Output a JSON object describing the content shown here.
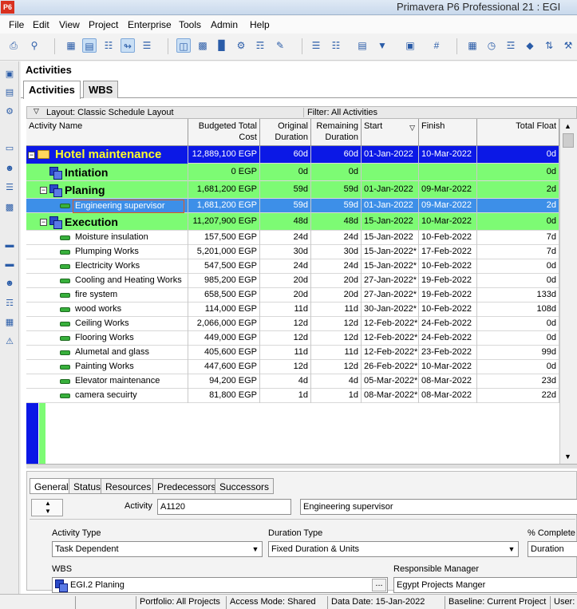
{
  "app": {
    "icon_text": "P6",
    "title": "Primavera P6 Professional 21 : EGI"
  },
  "menu": [
    "File",
    "Edit",
    "View",
    "Project",
    "Enterprise",
    "Tools",
    "Admin",
    "Help"
  ],
  "panel_title": "Activities",
  "top_tabs": [
    "Activities",
    "WBS"
  ],
  "layout_label": "Layout: Classic Schedule Layout",
  "filter_label": "Filter: All Activities",
  "columns": [
    {
      "label": "Activity Name"
    },
    {
      "label": "Budgeted Total Cost"
    },
    {
      "label": "Original Duration"
    },
    {
      "label": "Remaining Duration"
    },
    {
      "label": "Start"
    },
    {
      "label": "Finish"
    },
    {
      "label": "Total Float"
    }
  ],
  "rows": [
    {
      "type": "proj",
      "name": "Hotel maintenance",
      "cost": "12,889,100 EGP",
      "od": "60d",
      "rd": "60d",
      "start": "01-Jan-2022",
      "finish": "10-Mar-2022",
      "tf": "0d"
    },
    {
      "type": "wbs",
      "name": "Intiation",
      "cost": "0 EGP",
      "od": "0d",
      "rd": "0d",
      "start": "",
      "finish": "",
      "tf": "0d"
    },
    {
      "type": "wbs",
      "name": "Planing",
      "cost": "1,681,200 EGP",
      "od": "59d",
      "rd": "59d",
      "start": "01-Jan-2022",
      "finish": "09-Mar-2022",
      "tf": "2d"
    },
    {
      "type": "sel",
      "name": "Engineering supervisor",
      "cost": "1,681,200 EGP",
      "od": "59d",
      "rd": "59d",
      "start": "01-Jan-2022",
      "finish": "09-Mar-2022",
      "tf": "2d"
    },
    {
      "type": "wbs",
      "name": "Execution",
      "cost": "11,207,900 EGP",
      "od": "48d",
      "rd": "48d",
      "start": "15-Jan-2022",
      "finish": "10-Mar-2022",
      "tf": "0d"
    },
    {
      "type": "act",
      "name": "Moisture insulation",
      "cost": "157,500 EGP",
      "od": "24d",
      "rd": "24d",
      "start": "15-Jan-2022",
      "finish": "10-Feb-2022",
      "tf": "7d"
    },
    {
      "type": "act",
      "name": "Plumping Works",
      "cost": "5,201,000 EGP",
      "od": "30d",
      "rd": "30d",
      "start": "15-Jan-2022*",
      "finish": "17-Feb-2022",
      "tf": "7d"
    },
    {
      "type": "act",
      "name": "Electricity Works",
      "cost": "547,500 EGP",
      "od": "24d",
      "rd": "24d",
      "start": "15-Jan-2022*",
      "finish": "10-Feb-2022",
      "tf": "0d"
    },
    {
      "type": "act",
      "name": "Cooling and Heating Works",
      "cost": "985,200 EGP",
      "od": "20d",
      "rd": "20d",
      "start": "27-Jan-2022*",
      "finish": "19-Feb-2022",
      "tf": "0d"
    },
    {
      "type": "act",
      "name": "fire system",
      "cost": "658,500 EGP",
      "od": "20d",
      "rd": "20d",
      "start": "27-Jan-2022*",
      "finish": "19-Feb-2022",
      "tf": "133d"
    },
    {
      "type": "act",
      "name": "wood works",
      "cost": "114,000 EGP",
      "od": "11d",
      "rd": "11d",
      "start": "30-Jan-2022*",
      "finish": "10-Feb-2022",
      "tf": "108d"
    },
    {
      "type": "act",
      "name": "Ceiling Works",
      "cost": "2,066,000 EGP",
      "od": "12d",
      "rd": "12d",
      "start": "12-Feb-2022*",
      "finish": "24-Feb-2022",
      "tf": "0d"
    },
    {
      "type": "act",
      "name": "Flooring Works",
      "cost": "449,000 EGP",
      "od": "12d",
      "rd": "12d",
      "start": "12-Feb-2022*",
      "finish": "24-Feb-2022",
      "tf": "0d"
    },
    {
      "type": "act",
      "name": "Alumetal and glass",
      "cost": "405,600 EGP",
      "od": "11d",
      "rd": "11d",
      "start": "12-Feb-2022*",
      "finish": "23-Feb-2022",
      "tf": "99d"
    },
    {
      "type": "act",
      "name": "Painting Works",
      "cost": "447,600 EGP",
      "od": "12d",
      "rd": "12d",
      "start": "26-Feb-2022*",
      "finish": "10-Mar-2022",
      "tf": "0d"
    },
    {
      "type": "act",
      "name": "Elevator maintenance",
      "cost": "94,200 EGP",
      "od": "4d",
      "rd": "4d",
      "start": "05-Mar-2022*",
      "finish": "08-Mar-2022",
      "tf": "23d"
    },
    {
      "type": "act",
      "name": "camera secuirty",
      "cost": "81,800 EGP",
      "od": "1d",
      "rd": "1d",
      "start": "08-Mar-2022*",
      "finish": "08-Mar-2022",
      "tf": "22d"
    }
  ],
  "detail_tabs": [
    "General",
    "Status",
    "Resources",
    "Predecessors",
    "Successors"
  ],
  "details": {
    "activity_label": "Activity",
    "activity_id": "A1120",
    "activity_name": "Engineering supervisor",
    "activity_type_label": "Activity Type",
    "activity_type": "Task Dependent",
    "duration_type_label": "Duration Type",
    "duration_type": "Fixed Duration & Units",
    "pct_complete_label": "% Complete T",
    "pct_complete_type": "Duration",
    "wbs_label": "WBS",
    "wbs_value": "EGI.2  Planing",
    "wbs_btn": "...",
    "resp_mgr_label": "Responsible Manager",
    "resp_mgr": "Egypt Projects Manger"
  },
  "status": {
    "portfolio": "Portfolio: All Projects",
    "access": "Access Mode: Shared",
    "data_date": "Data Date: 15-Jan-2022",
    "baseline": "Baseline: Current Project",
    "user": "User:"
  },
  "colors": {
    "project_row": "#0b18e6",
    "wbs_row": "#7dfb74",
    "selected_row": "#3d8fe8"
  }
}
